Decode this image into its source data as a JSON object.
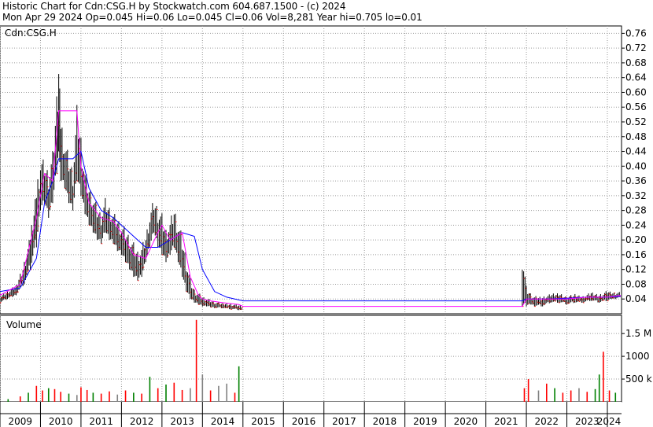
{
  "header": {
    "line1": "Historic Chart for Cdn:CSG.H by Stockwatch.com 604.687.1500 - (c) 2024",
    "line2": "Mon Apr 29 2024  Op=0.045  Hi=0.06  Lo=0.045  Cl=0.06  Vol=8,281  Year hi=0.705  lo=0.01"
  },
  "chart_data": {
    "type": "line",
    "symbol": "Cdn:CSG.H",
    "price_panel": {
      "label": "Cdn:CSG.H",
      "y_ticks": [
        0.04,
        0.08,
        0.12,
        0.16,
        0.2,
        0.24,
        0.28,
        0.32,
        0.36,
        0.4,
        0.44,
        0.48,
        0.52,
        0.56,
        0.6,
        0.64,
        0.68,
        0.72,
        0.76
      ],
      "y_tick_labels": [
        "0.04",
        "0.08",
        "0.12",
        "0.16",
        "0.20",
        "0.24",
        "0.28",
        "0.32",
        "0.36",
        "0.40",
        "0.44",
        "0.48",
        "0.52",
        "0.56",
        "0.60",
        "0.64",
        "0.68",
        "0.72",
        "0.76"
      ],
      "ylim": [
        0.0,
        0.78
      ],
      "grid": true,
      "price_range_series": {
        "name": "",
        "x": [
          2009.0,
          2009.4,
          2009.6,
          2009.75,
          2009.9,
          2010.0,
          2010.1,
          2010.2,
          2010.3,
          2010.4,
          2010.45,
          2010.5,
          2010.6,
          2010.7,
          2010.8,
          2010.9,
          2011.0,
          2011.1,
          2011.2,
          2011.3,
          2011.4,
          2011.5,
          2011.6,
          2011.7,
          2011.8,
          2011.9,
          2012.0,
          2012.1,
          2012.2,
          2012.3,
          2012.4,
          2012.5,
          2012.6,
          2012.7,
          2012.8,
          2012.9,
          2013.0,
          2013.1,
          2013.2,
          2013.3,
          2013.4,
          2013.5,
          2013.6,
          2013.7,
          2013.8,
          2013.9,
          2014.0,
          2014.1,
          2014.2,
          2014.3,
          2014.5,
          2014.7,
          2014.9,
          2015.0
        ],
        "high": [
          0.05,
          0.08,
          0.15,
          0.22,
          0.36,
          0.44,
          0.42,
          0.4,
          0.45,
          0.62,
          0.7,
          0.55,
          0.48,
          0.44,
          0.4,
          0.58,
          0.5,
          0.4,
          0.36,
          0.33,
          0.3,
          0.28,
          0.32,
          0.3,
          0.28,
          0.27,
          0.25,
          0.24,
          0.22,
          0.2,
          0.18,
          0.19,
          0.22,
          0.28,
          0.32,
          0.3,
          0.28,
          0.24,
          0.26,
          0.3,
          0.26,
          0.22,
          0.16,
          0.1,
          0.07,
          0.06,
          0.05,
          0.045,
          0.04,
          0.035,
          0.03,
          0.03,
          0.025,
          0.02
        ],
        "low": [
          0.03,
          0.05,
          0.08,
          0.12,
          0.18,
          0.28,
          0.3,
          0.26,
          0.3,
          0.38,
          0.44,
          0.36,
          0.34,
          0.3,
          0.28,
          0.36,
          0.32,
          0.27,
          0.24,
          0.22,
          0.2,
          0.19,
          0.22,
          0.2,
          0.19,
          0.17,
          0.16,
          0.14,
          0.12,
          0.1,
          0.09,
          0.1,
          0.14,
          0.18,
          0.22,
          0.18,
          0.16,
          0.14,
          0.16,
          0.18,
          0.14,
          0.1,
          0.06,
          0.04,
          0.03,
          0.025,
          0.02,
          0.02,
          0.018,
          0.015,
          0.015,
          0.012,
          0.01,
          0.01
        ]
      },
      "price_range_series_2": {
        "name": "",
        "x": [
          2021.9,
          2022.0,
          2022.1,
          2022.2,
          2022.4,
          2022.6,
          2022.8,
          2023.0,
          2023.2,
          2023.4,
          2023.6,
          2023.8,
          2024.0,
          2024.1,
          2024.2,
          2024.33
        ],
        "high": [
          0.2,
          0.08,
          0.06,
          0.05,
          0.05,
          0.055,
          0.06,
          0.05,
          0.055,
          0.05,
          0.06,
          0.055,
          0.065,
          0.06,
          0.06,
          0.06
        ],
        "low": [
          0.02,
          0.02,
          0.025,
          0.02,
          0.02,
          0.03,
          0.03,
          0.025,
          0.03,
          0.03,
          0.035,
          0.03,
          0.035,
          0.04,
          0.04,
          0.045
        ]
      },
      "ma_short": {
        "name": "",
        "color": "#ff00ff",
        "x": [
          2009.0,
          2009.5,
          2009.9,
          2010.1,
          2010.3,
          2010.45,
          2010.8,
          2010.9,
          2011.0,
          2011.2,
          2011.5,
          2011.8,
          2012.0,
          2012.3,
          2012.6,
          2012.9,
          2013.0,
          2013.2,
          2013.5,
          2013.7,
          2013.9,
          2014.0,
          2014.2,
          2014.5,
          2014.9,
          2015.0,
          2021.9,
          2022.0,
          2022.5,
          2023.0,
          2023.5,
          2024.0,
          2024.33
        ],
        "values": [
          0.05,
          0.08,
          0.26,
          0.38,
          0.36,
          0.55,
          0.55,
          0.55,
          0.4,
          0.3,
          0.26,
          0.25,
          0.22,
          0.16,
          0.15,
          0.22,
          0.24,
          0.2,
          0.22,
          0.1,
          0.05,
          0.04,
          0.035,
          0.03,
          0.025,
          0.02,
          0.02,
          0.04,
          0.04,
          0.04,
          0.045,
          0.045,
          0.05
        ]
      },
      "ma_long": {
        "name": "",
        "color": "#0000ff",
        "x": [
          2009.0,
          2009.5,
          2009.9,
          2010.1,
          2010.3,
          2010.45,
          2010.8,
          2011.0,
          2011.2,
          2011.5,
          2011.8,
          2012.0,
          2012.3,
          2012.6,
          2012.9,
          2013.2,
          2013.5,
          2013.8,
          2014.0,
          2014.3,
          2014.6,
          2015.0,
          2021.9,
          2022.0,
          2022.5,
          2023.0,
          2023.5,
          2024.0,
          2024.33
        ],
        "values": [
          0.06,
          0.07,
          0.15,
          0.3,
          0.36,
          0.42,
          0.42,
          0.44,
          0.34,
          0.28,
          0.26,
          0.24,
          0.21,
          0.18,
          0.18,
          0.2,
          0.22,
          0.21,
          0.12,
          0.06,
          0.045,
          0.035,
          0.035,
          0.04,
          0.04,
          0.042,
          0.045,
          0.045,
          0.047
        ]
      }
    },
    "volume_panel": {
      "label": "Volume",
      "y_tick_labels": [
        "500 k",
        "1000",
        "1.5 M"
      ],
      "y_ticks": [
        500000,
        1000000,
        1500000
      ],
      "ylim": [
        0,
        1900000
      ],
      "bars": {
        "x": [
          2009.2,
          2009.5,
          2009.7,
          2009.9,
          2010.05,
          2010.2,
          2010.35,
          2010.5,
          2010.7,
          2010.9,
          2011.0,
          2011.15,
          2011.3,
          2011.5,
          2011.7,
          2011.9,
          2012.1,
          2012.3,
          2012.5,
          2012.7,
          2012.9,
          2013.1,
          2013.3,
          2013.5,
          2013.7,
          2013.85,
          2014.0,
          2014.2,
          2014.4,
          2014.6,
          2014.8,
          2014.9,
          2021.95,
          2022.05,
          2022.3,
          2022.5,
          2022.7,
          2022.9,
          2023.1,
          2023.3,
          2023.5,
          2023.7,
          2023.8,
          2023.9,
          2024.05,
          2024.2
        ],
        "values": [
          60000,
          120000,
          200000,
          350000,
          250000,
          300000,
          280000,
          220000,
          180000,
          150000,
          320000,
          260000,
          200000,
          180000,
          230000,
          160000,
          250000,
          200000,
          180000,
          550000,
          300000,
          380000,
          420000,
          260000,
          300000,
          1800000,
          600000,
          250000,
          350000,
          400000,
          200000,
          780000,
          300000,
          500000,
          250000,
          400000,
          300000,
          200000,
          250000,
          300000,
          220000,
          280000,
          600000,
          1100000,
          250000,
          200000
        ],
        "colors": [
          "#008000",
          "#ff0000",
          "#008000",
          "#ff0000",
          "#ff0000",
          "#008000",
          "#ff0000",
          "#ff0000",
          "#008000",
          "#808080",
          "#ff0000",
          "#ff0000",
          "#008000",
          "#ff0000",
          "#ff0000",
          "#808080",
          "#ff0000",
          "#008000",
          "#ff0000",
          "#008000",
          "#ff0000",
          "#008000",
          "#ff0000",
          "#ff0000",
          "#808080",
          "#ff0000",
          "#808080",
          "#ff0000",
          "#808080",
          "#808080",
          "#ff0000",
          "#008000",
          "#ff0000",
          "#ff0000",
          "#808080",
          "#ff0000",
          "#008000",
          "#ff0000",
          "#ff0000",
          "#808080",
          "#ff0000",
          "#008000",
          "#008000",
          "#ff0000",
          "#ff0000",
          "#008000"
        ]
      }
    },
    "x_axis": {
      "tick_labels": [
        "2009",
        "2010",
        "2011",
        "2012",
        "2013",
        "2014",
        "2015",
        "2016",
        "2017",
        "2018",
        "2019",
        "2020",
        "2021",
        "2022",
        "2023",
        "2024"
      ],
      "tick_years": [
        2009,
        2010,
        2011,
        2012,
        2013,
        2014,
        2015,
        2016,
        2017,
        2018,
        2019,
        2020,
        2021,
        2022,
        2023,
        2024
      ],
      "xlim": [
        2009.0,
        2024.35
      ]
    }
  }
}
